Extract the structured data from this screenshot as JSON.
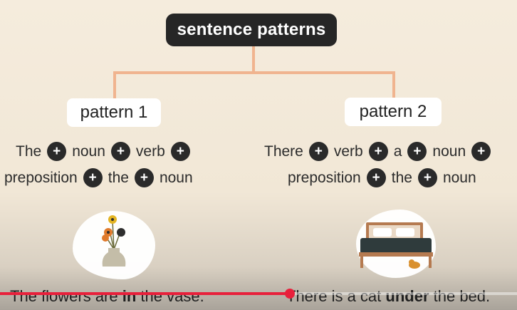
{
  "diagram": {
    "title": "sentence patterns",
    "patterns": [
      {
        "label": "pattern 1",
        "line1": [
          "The",
          "noun",
          "verb"
        ],
        "line2": [
          "preposition",
          "the",
          "noun"
        ],
        "caption_before": "The flowers are ",
        "caption_bold": "in",
        "caption_after": " the vase."
      },
      {
        "label": "pattern 2",
        "line1": [
          "There",
          "verb",
          "a",
          "noun"
        ],
        "line2": [
          "preposition",
          "the",
          "noun"
        ],
        "caption_before": "There is a cat ",
        "caption_bold": "under",
        "caption_after": " the bed."
      }
    ]
  },
  "player": {
    "progress_fraction": 0.56,
    "progress_color": "#e8203b"
  },
  "colors": {
    "connector": "#f0b48f",
    "title_bg": "#262626",
    "plus_bg": "#2a2a2a"
  },
  "icons": {
    "plus": "plus-icon",
    "vase": "flower-vase-illustration",
    "bed": "bed-with-cat-illustration"
  }
}
